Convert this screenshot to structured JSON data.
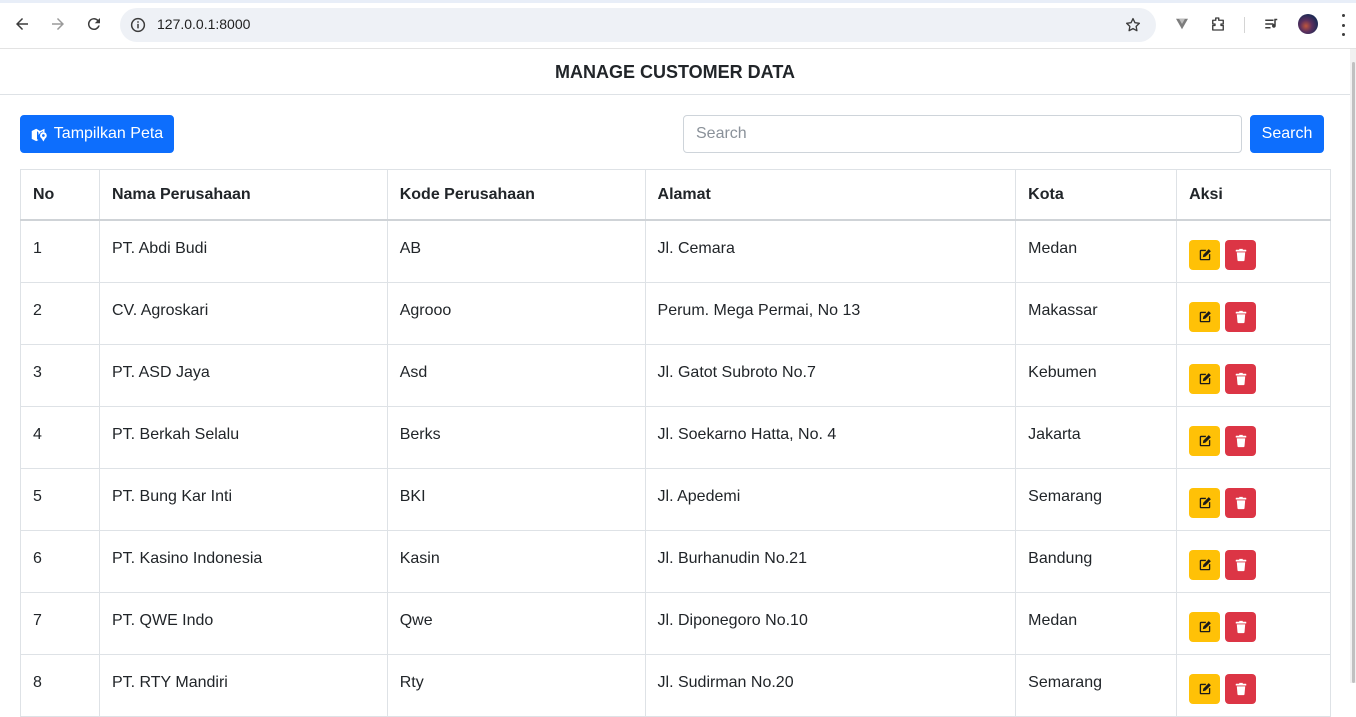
{
  "browser": {
    "url": "127.0.0.1:8000"
  },
  "page": {
    "title": "MANAGE CUSTOMER DATA"
  },
  "toolbar": {
    "map_button_label": "Tampilkan Peta",
    "search_placeholder": "Search",
    "search_value": "",
    "search_button_label": "Search"
  },
  "table": {
    "headers": {
      "no": "No",
      "nama": "Nama Perusahaan",
      "kode": "Kode Perusahaan",
      "alamat": "Alamat",
      "kota": "Kota",
      "aksi": "Aksi"
    },
    "rows": [
      {
        "no": "1",
        "nama": "PT. Abdi Budi",
        "kode": "AB",
        "alamat": "Jl. Cemara",
        "kota": "Medan"
      },
      {
        "no": "2",
        "nama": "CV. Agroskari",
        "kode": "Agrooo",
        "alamat": "Perum. Mega Permai, No 13",
        "kota": "Makassar"
      },
      {
        "no": "3",
        "nama": "PT. ASD Jaya",
        "kode": "Asd",
        "alamat": "Jl. Gatot Subroto No.7",
        "kota": "Kebumen"
      },
      {
        "no": "4",
        "nama": "PT. Berkah Selalu",
        "kode": "Berks",
        "alamat": "Jl. Soekarno Hatta, No. 4",
        "kota": "Jakarta"
      },
      {
        "no": "5",
        "nama": "PT. Bung Kar Inti",
        "kode": "BKI",
        "alamat": "Jl. Apedemi",
        "kota": "Semarang"
      },
      {
        "no": "6",
        "nama": "PT. Kasino Indonesia",
        "kode": "Kasin",
        "alamat": "Jl. Burhanudin No.21",
        "kota": "Bandung"
      },
      {
        "no": "7",
        "nama": "PT. QWE Indo",
        "kode": "Qwe",
        "alamat": "Jl. Diponegoro No.10",
        "kota": "Medan"
      },
      {
        "no": "8",
        "nama": "PT. RTY Mandiri",
        "kode": "Rty",
        "alamat": "Jl. Sudirman No.20",
        "kota": "Semarang"
      }
    ]
  },
  "colors": {
    "primary": "#0d6efd",
    "edit": "#ffc107",
    "delete": "#dc3545"
  },
  "icons": {
    "map_button": "map-icon",
    "edit_action": "edit-icon",
    "delete_action": "trash-icon"
  }
}
